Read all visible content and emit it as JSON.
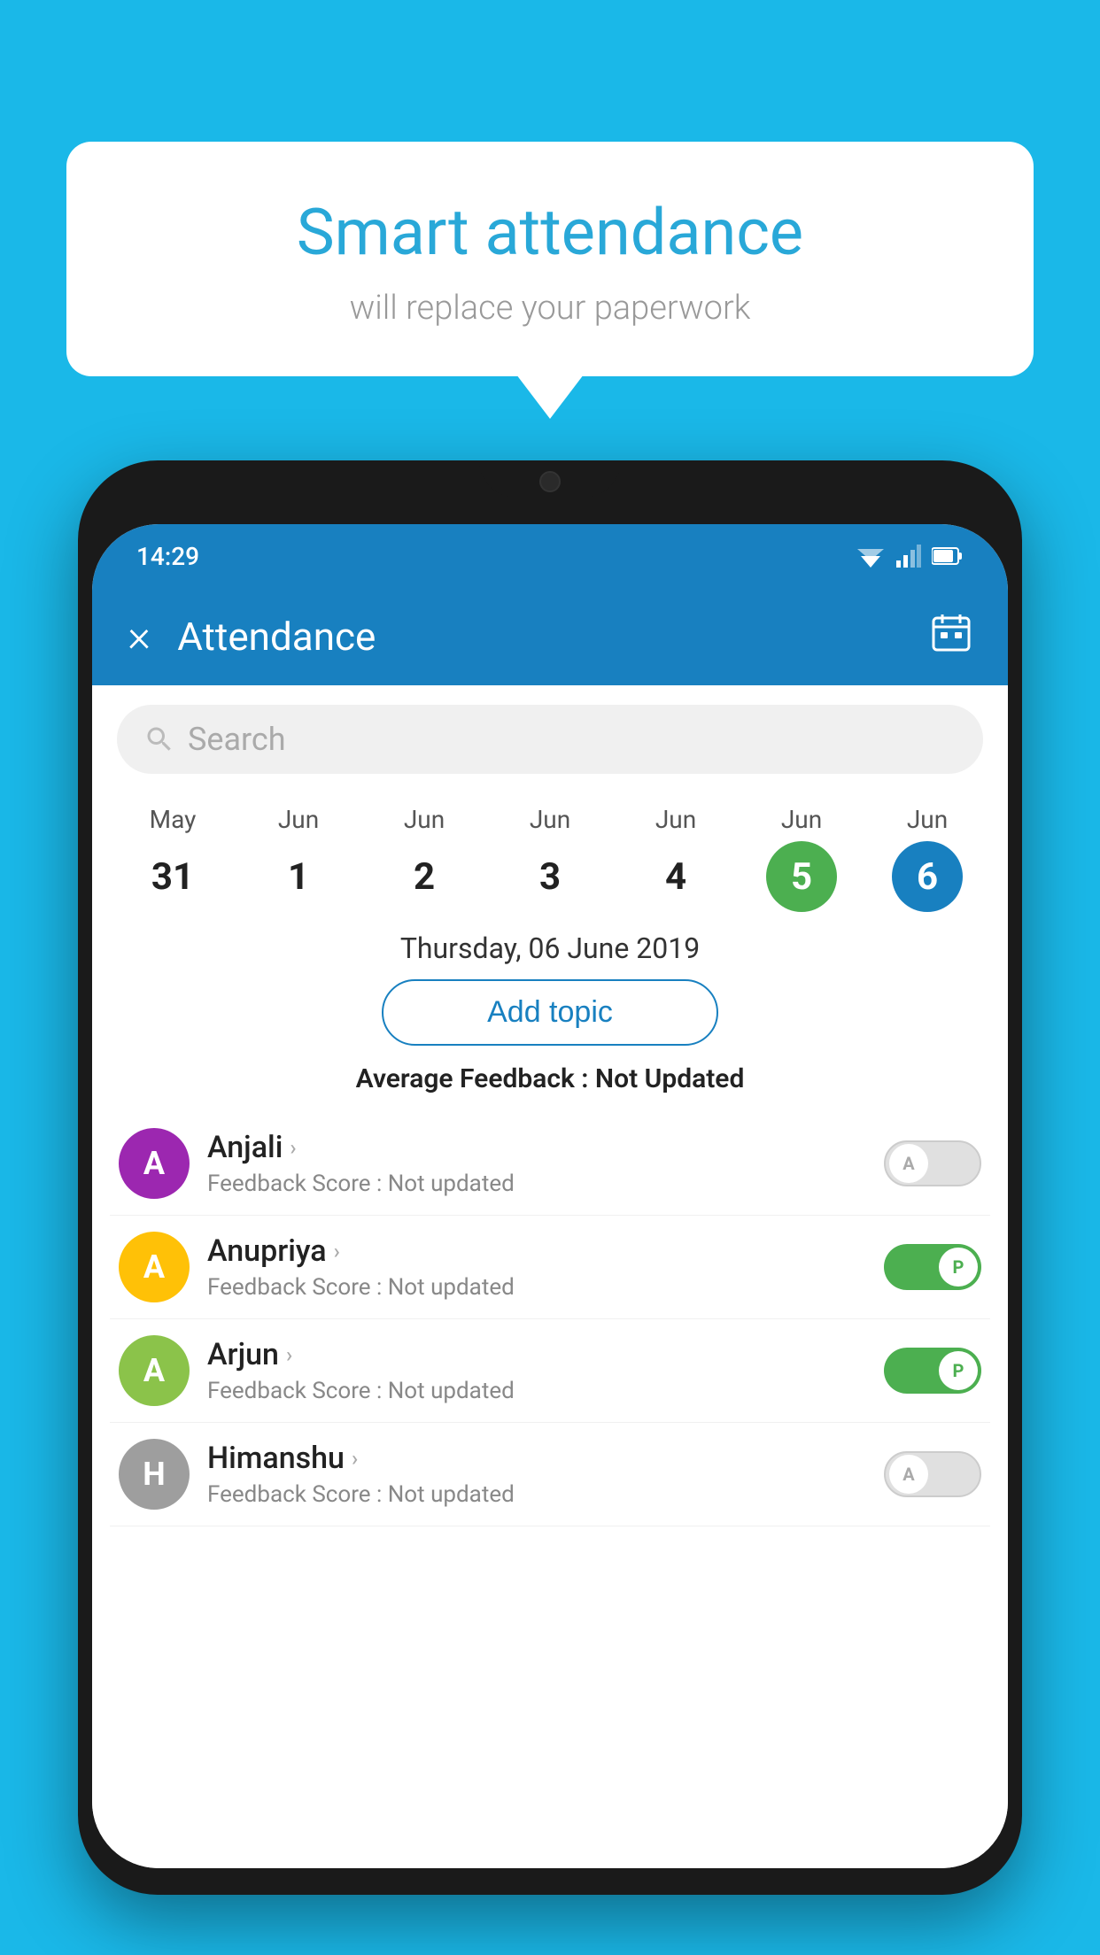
{
  "background_color": "#1ab8e8",
  "bubble": {
    "title": "Smart attendance",
    "subtitle": "will replace your paperwork"
  },
  "phone": {
    "status_bar": {
      "time": "14:29"
    },
    "app_bar": {
      "title": "Attendance",
      "close_label": "×",
      "calendar_label": "📅"
    },
    "search": {
      "placeholder": "Search"
    },
    "calendar": {
      "days": [
        {
          "month": "May",
          "date": "31",
          "state": "normal"
        },
        {
          "month": "Jun",
          "date": "1",
          "state": "normal"
        },
        {
          "month": "Jun",
          "date": "2",
          "state": "normal"
        },
        {
          "month": "Jun",
          "date": "3",
          "state": "normal"
        },
        {
          "month": "Jun",
          "date": "4",
          "state": "normal"
        },
        {
          "month": "Jun",
          "date": "5",
          "state": "today"
        },
        {
          "month": "Jun",
          "date": "6",
          "state": "selected"
        }
      ]
    },
    "selected_date": "Thursday, 06 June 2019",
    "add_topic_label": "Add topic",
    "avg_feedback_label": "Average Feedback :",
    "avg_feedback_value": "Not Updated",
    "students": [
      {
        "name": "Anjali",
        "avatar_letter": "A",
        "avatar_color": "#9c27b0",
        "score_label": "Feedback Score :",
        "score_value": "Not updated",
        "toggle": "off",
        "toggle_letter": "A"
      },
      {
        "name": "Anupriya",
        "avatar_letter": "A",
        "avatar_color": "#ffc107",
        "score_label": "Feedback Score :",
        "score_value": "Not updated",
        "toggle": "on",
        "toggle_letter": "P"
      },
      {
        "name": "Arjun",
        "avatar_letter": "A",
        "avatar_color": "#8bc34a",
        "score_label": "Feedback Score :",
        "score_value": "Not updated",
        "toggle": "on",
        "toggle_letter": "P"
      },
      {
        "name": "Himanshu",
        "avatar_letter": "H",
        "avatar_color": "#9e9e9e",
        "score_label": "Feedback Score :",
        "score_value": "Not updated",
        "toggle": "off",
        "toggle_letter": "A"
      }
    ]
  }
}
